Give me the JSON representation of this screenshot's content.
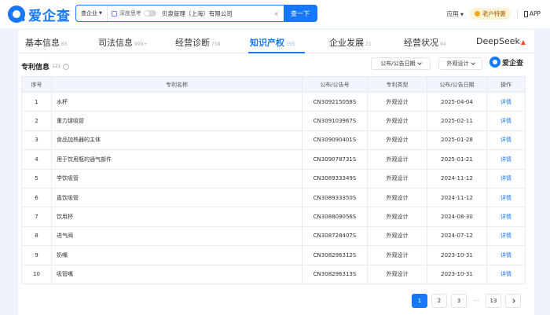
{
  "header": {
    "logo_text": "爱企查",
    "search": {
      "scope": "查企业",
      "deep_label": "深度思考",
      "value": "贝泉管理（上海）有限公司",
      "clear": "×",
      "button": "查一下"
    },
    "menu_app": "应用",
    "vip_label": "老户特惠",
    "app_label": "APP"
  },
  "tabs": [
    {
      "label": "基本信息",
      "count": "65"
    },
    {
      "label": "司法信息",
      "count": "999+"
    },
    {
      "label": "经营诊断",
      "count": "758"
    },
    {
      "label": "知识产权",
      "count": "355"
    },
    {
      "label": "企业发展",
      "count": "21"
    },
    {
      "label": "经营状况",
      "count": "94"
    },
    {
      "label": "DeepSeek",
      "count": ""
    }
  ],
  "section": {
    "title": "专利信息",
    "count": "121",
    "help": "?",
    "filter_date": "公布/公告日期",
    "filter_type": "外观设计",
    "brand": "爱企查"
  },
  "table": {
    "headers": [
      "序号",
      "专利名称",
      "公布/公告号",
      "专利类型",
      "公布/公告日期",
      "操作"
    ],
    "rows": [
      {
        "no": "1",
        "name": "水杯",
        "pub": "CN309215058S",
        "type": "外观设计",
        "date": "2025-04-04",
        "op": "详情"
      },
      {
        "no": "2",
        "name": "重力球吸管",
        "pub": "CN309103967S",
        "type": "外观设计",
        "date": "2025-02-11",
        "op": "详情"
      },
      {
        "no": "3",
        "name": "食品加热器的主体",
        "pub": "CN309090401S",
        "type": "外观设计",
        "date": "2025-01-28",
        "op": "详情"
      },
      {
        "no": "4",
        "name": "用于饮用瓶的通气部件",
        "pub": "CN309078731S",
        "type": "外观设计",
        "date": "2025-01-21",
        "op": "详情"
      },
      {
        "no": "5",
        "name": "学饮吸管",
        "pub": "CN308933349S",
        "type": "外观设计",
        "date": "2024-11-12",
        "op": "详情"
      },
      {
        "no": "6",
        "name": "直饮吸管",
        "pub": "CN308933350S",
        "type": "外观设计",
        "date": "2024-11-12",
        "op": "详情"
      },
      {
        "no": "7",
        "name": "饮用杯",
        "pub": "CN308809056S",
        "type": "外观设计",
        "date": "2024-08-30",
        "op": "详情"
      },
      {
        "no": "8",
        "name": "进气阀",
        "pub": "CN308728407S",
        "type": "外观设计",
        "date": "2024-07-12",
        "op": "详情"
      },
      {
        "no": "9",
        "name": "奶嘴",
        "pub": "CN308296312S",
        "type": "外观设计",
        "date": "2023-10-31",
        "op": "详情"
      },
      {
        "no": "10",
        "name": "吸管嘴",
        "pub": "CN308296313S",
        "type": "外观设计",
        "date": "2023-10-31",
        "op": "详情"
      }
    ]
  },
  "pagination": {
    "pages": [
      "1",
      "2",
      "3"
    ],
    "ellipsis": "···",
    "last": "13",
    "current": "1"
  },
  "colors": {
    "accent": "#1677ff",
    "background": "#eef2f9",
    "table_header": "#f2f6fc"
  }
}
